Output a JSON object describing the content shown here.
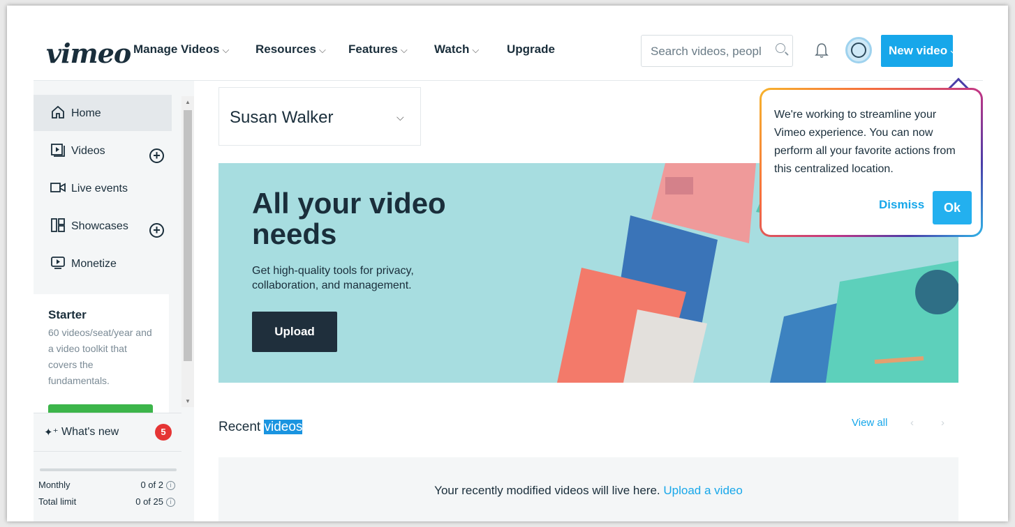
{
  "header": {
    "logo": "vimeo",
    "nav": [
      {
        "label": "Manage Videos"
      },
      {
        "label": "Resources"
      },
      {
        "label": "Features"
      },
      {
        "label": "Watch"
      },
      {
        "label": "Upgrade"
      }
    ],
    "search_placeholder": "Search videos, peopl",
    "new_video_label": "New video"
  },
  "sidebar": {
    "items": [
      {
        "label": "Home",
        "icon": "home-icon"
      },
      {
        "label": "Videos",
        "icon": "video-library-icon"
      },
      {
        "label": "Live events",
        "icon": "camera-icon"
      },
      {
        "label": "Showcases",
        "icon": "showcase-icon"
      },
      {
        "label": "Monetize",
        "icon": "monetize-icon"
      }
    ],
    "plan": {
      "title": "Starter",
      "description": "60 videos/seat/year and a video toolkit that covers the fundamentals."
    },
    "whats_new": {
      "label": "What's new",
      "count": "5"
    },
    "limits": [
      {
        "label": "Monthly",
        "value": "0 of 2"
      },
      {
        "label": "Total limit",
        "value": "0 of 25"
      }
    ]
  },
  "main": {
    "user_name": "Susan Walker",
    "hero": {
      "title": "All your video needs",
      "subtitle": "Get high-quality tools for privacy, collaboration, and management.",
      "button": "Upload"
    },
    "recent": {
      "title_prefix": "Recent ",
      "title_highlight": "videos",
      "view_all": "View all",
      "empty_text": "Your recently modified videos will live here.",
      "empty_link": "Upload a video"
    }
  },
  "tooltip": {
    "text": "We're working to streamline your Vimeo experience. You can now perform all your favorite actions from this centralized location.",
    "dismiss": "Dismiss",
    "ok": "Ok"
  },
  "colors": {
    "accent": "#17a7ea",
    "hero_bg": "#a7dde0",
    "badge": "#e53535",
    "dark_button": "#1f2f3c"
  }
}
